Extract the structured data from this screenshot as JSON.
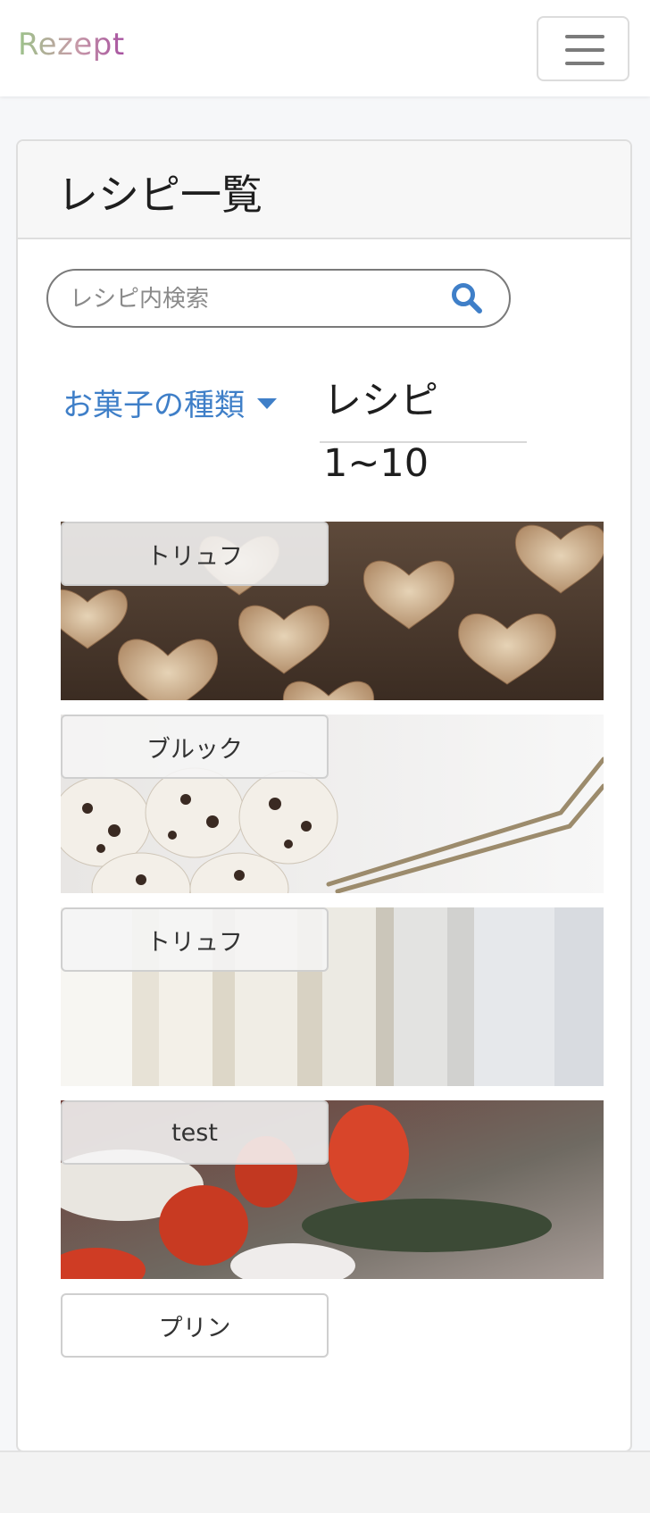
{
  "navbar": {
    "brand": "Rezept",
    "menu_icon": "hamburger-icon"
  },
  "page": {
    "title": "レシピ一覧"
  },
  "search": {
    "placeholder": "レシピ内検索",
    "icon": "search-icon"
  },
  "filter": {
    "category_label": "お菓子の種類",
    "range_label": "レシピ1~10"
  },
  "recipes": [
    {
      "name": "トリュフ",
      "image": "heart-cookies"
    },
    {
      "name": "ブルック",
      "image": "cupcakes-with-tongs"
    },
    {
      "name": "トリュフ",
      "image": "curtain"
    },
    {
      "name": "test",
      "image": "tulips"
    },
    {
      "name": "プリン",
      "image": ""
    }
  ],
  "colors": {
    "link": "#3f7fc8",
    "brand_gradient": [
      "#9cc28a",
      "#a64fa0"
    ]
  }
}
